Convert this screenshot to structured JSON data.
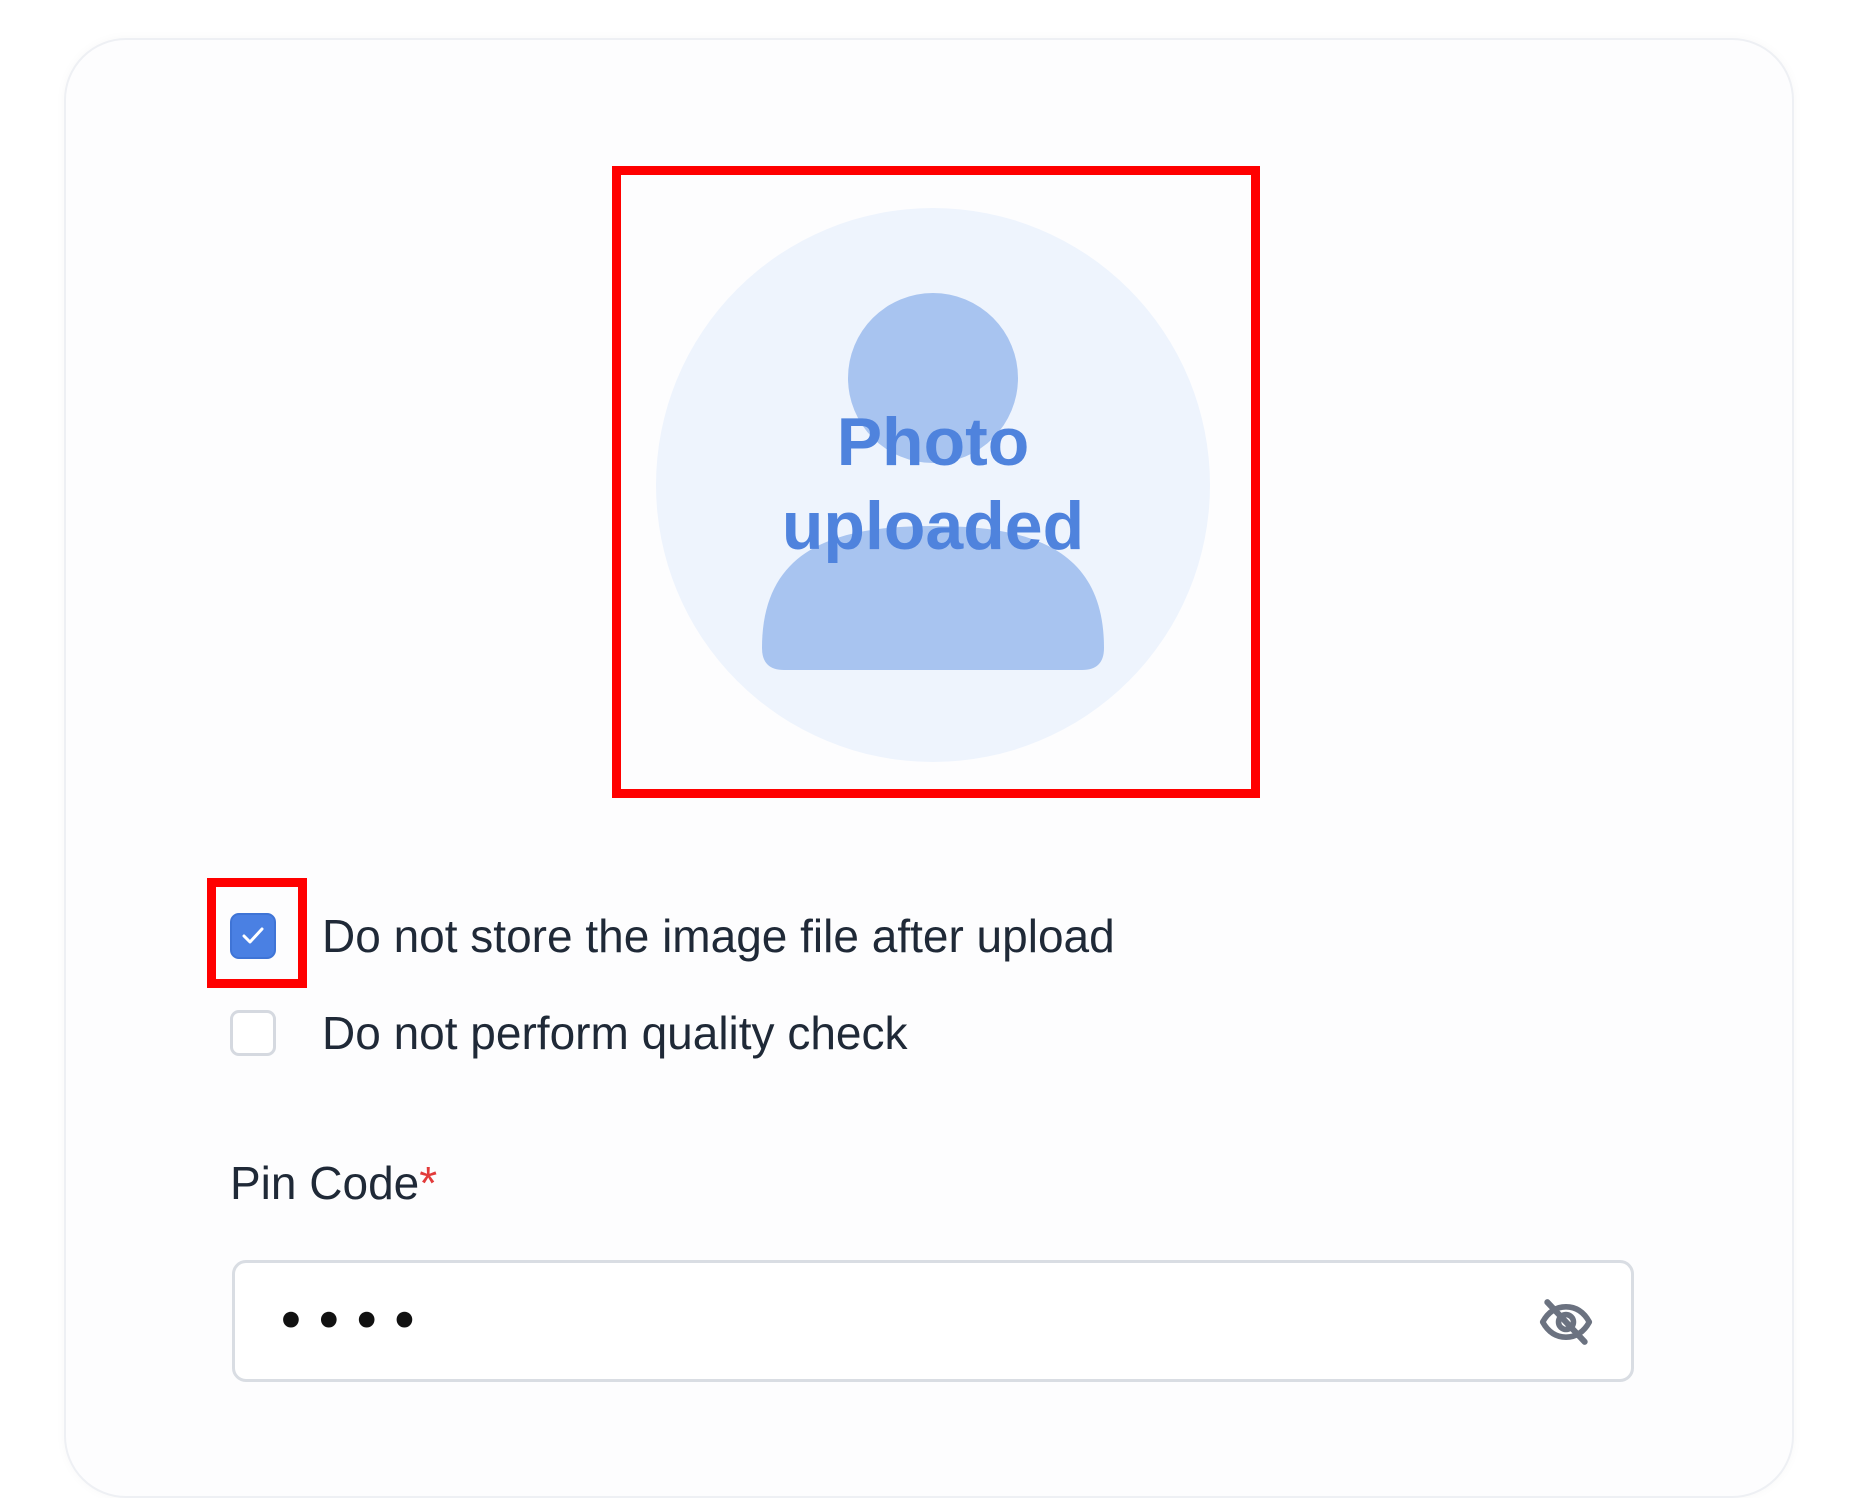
{
  "avatar": {
    "status_text_line1": "Photo",
    "status_text_line2": "uploaded",
    "icon": "user-silhouette-icon"
  },
  "options": {
    "no_store": {
      "label": "Do not store the image file after upload",
      "checked": true
    },
    "no_quality_check": {
      "label": "Do not perform quality check",
      "checked": false
    }
  },
  "pin_code": {
    "label": "Pin Code",
    "required_marker": "*",
    "masked_value": "••••",
    "visibility_icon": "eye-slash-icon"
  },
  "colors": {
    "accent": "#4a80e3",
    "avatar_bg": "#eef4fd",
    "avatar_figure": "#a8c4f0",
    "highlight": "#ff0000",
    "required": "#e23b3b"
  }
}
